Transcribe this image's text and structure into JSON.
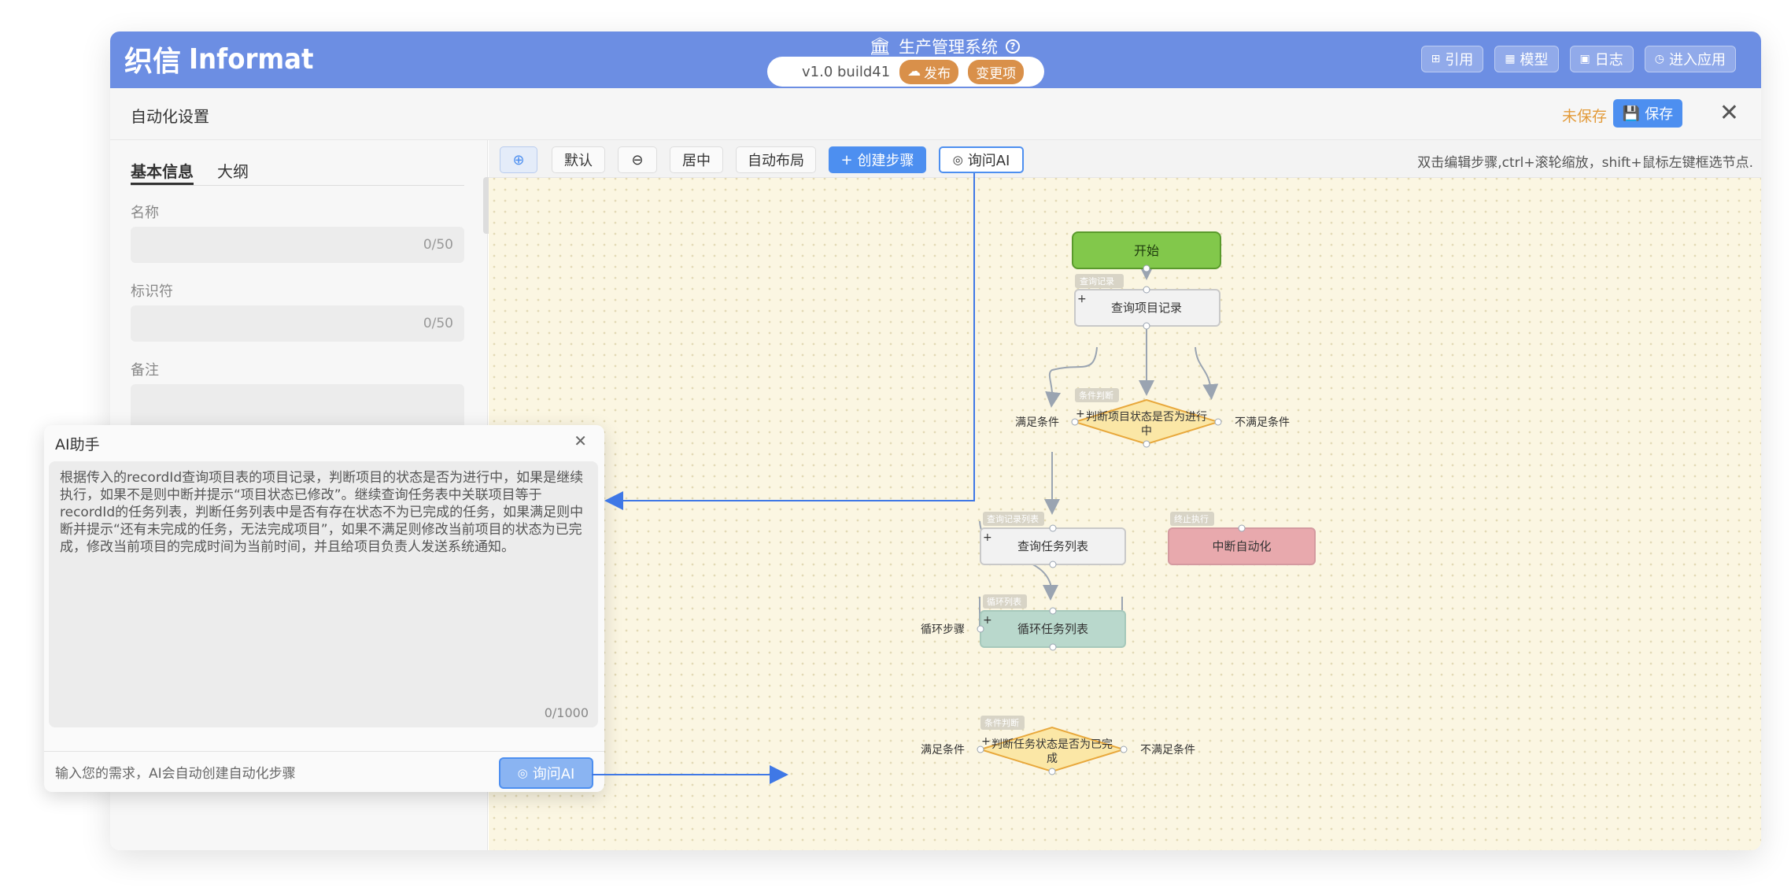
{
  "brand": {
    "logo_mark": "织信",
    "logo_text": "Informat"
  },
  "header": {
    "system_title": "生产管理系统",
    "version": "v1.0 build41",
    "publish_label": "发布",
    "changes_label": "变更项"
  },
  "top_actions": [
    {
      "label": "引用",
      "icon": "reference-icon"
    },
    {
      "label": "模型",
      "icon": "model-icon"
    },
    {
      "label": "日志",
      "icon": "log-icon"
    },
    {
      "label": "进入应用",
      "icon": "enter-app-icon"
    }
  ],
  "subheader": {
    "title": "自动化设置",
    "unsaved": "未保存",
    "save_label": "保存"
  },
  "left_panel": {
    "tabs": [
      "基本信息",
      "大纲"
    ],
    "fields": [
      {
        "label": "名称",
        "counter": "0/50"
      },
      {
        "label": "标识符",
        "counter": "0/50"
      },
      {
        "label": "备注",
        "counter": ""
      }
    ]
  },
  "toolbar": {
    "default_label": "默认",
    "center_label": "居中",
    "auto_layout_label": "自动布局",
    "create_step_label": "创建步骤",
    "ask_ai_label": "询问AI",
    "hint": "双击编辑步骤,ctrl+滚轮缩放，shift+鼠标左键框选节点."
  },
  "diagram": {
    "start": "开始",
    "query_record_tag": "查询记录",
    "query_record": "查询项目记录",
    "cond1_tag": "条件判断",
    "cond1_line1": "判断项目状态是否为进行",
    "cond1_line2": "中",
    "cond1_yes": "满足条件",
    "cond1_no": "不满足条件",
    "query_list_tag": "查询记录列表",
    "query_list": "查询任务列表",
    "stop_tag": "终止执行",
    "stop": "中断自动化",
    "loop_tag": "循环列表",
    "loop": "循环任务列表",
    "loop_side": "循环步骤",
    "cond2_tag": "条件判断",
    "cond2_line1": "判断任务状态是否为已完",
    "cond2_line2": "成",
    "cond2_yes": "满足条件",
    "cond2_no": "不满足条件"
  },
  "ai_dialog": {
    "title": "AI助手",
    "prompt": "根据传入的recordId查询项目表的项目记录，判断项目的状态是否为进行中，如果是继续执行，如果不是则中断并提示“项目状态已修改”。继续查询任务表中关联项目等于recordId的任务列表，判断任务列表中是否有存在状态不为已完成的任务，如果满足则中断并提示“还有未完成的任务，无法完成项目”，如果不满足则修改当前项目的状态为已完成，修改当前项目的完成时间为当前时间，并且给项目负责人发送系统通知。",
    "counter": "0/1000",
    "input_hint": "输入您的需求，AI会自动创建自动化步骤",
    "ask_label": "询问AI"
  },
  "colors": {
    "header_blue": "#6c8ee3",
    "primary": "#4d8ff0",
    "start_node": "#82c84b",
    "stop_node": "#e8a9ad",
    "loop_node": "#b9d8cc",
    "condition_fill": "#fbe7a6",
    "condition_border": "#e8a83c"
  }
}
